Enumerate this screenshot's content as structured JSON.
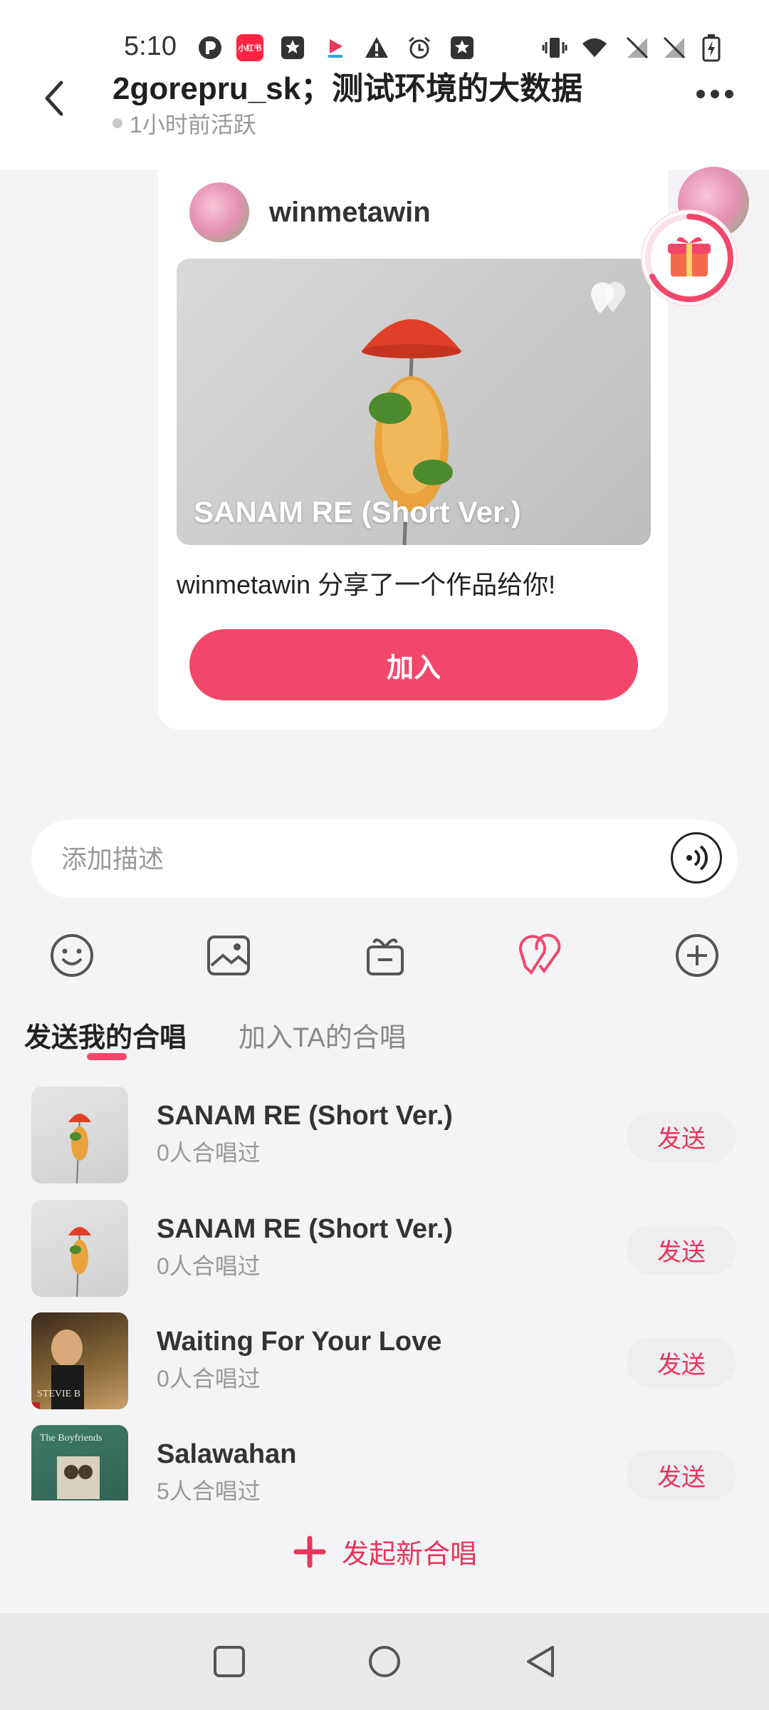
{
  "status_bar": {
    "time": "5:10",
    "icons": [
      "p-icon",
      "xiaohongshu-icon",
      "star-badge-icon",
      "bilibili-like-icon",
      "warning-icon",
      "alarm-icon",
      "star-badge-icon",
      "vibrate-icon",
      "wifi-icon",
      "no-sim-icon",
      "no-sim-icon",
      "battery-charging-icon"
    ],
    "xhs_label": "小红书"
  },
  "header": {
    "title": "2gorepru_sk；测试环境的大数据",
    "subtitle": "1小时前活跃"
  },
  "card": {
    "username": "winmetawin",
    "cover_title": "SANAM RE (Short Ver.)",
    "share_text": "winmetawin 分享了一个作品给你!",
    "join_label": "加入"
  },
  "input": {
    "placeholder": "添加描述"
  },
  "toolbar": {
    "items": [
      "emoji-icon",
      "image-icon",
      "gift-icon",
      "chorus-icon",
      "plus-icon"
    ]
  },
  "tabs": [
    {
      "label": "发送我的合唱",
      "active": true
    },
    {
      "label": "加入TA的合唱",
      "active": false
    }
  ],
  "songs": [
    {
      "title": "SANAM RE (Short Ver.)",
      "count": "0人合唱过",
      "send": "发送"
    },
    {
      "title": "SANAM RE (Short Ver.)",
      "count": "0人合唱过",
      "send": "发送"
    },
    {
      "title": "Waiting For Your Love",
      "count": "0人合唱过",
      "send": "发送"
    },
    {
      "title": "Salawahan",
      "count": "5人合唱过",
      "send": "发送"
    }
  ],
  "album_text": {
    "boyfriends": "The Boyfriends",
    "stevie": "STEVIE B"
  },
  "new_chorus_label": "发起新合唱",
  "accent_color": "#f2476b"
}
